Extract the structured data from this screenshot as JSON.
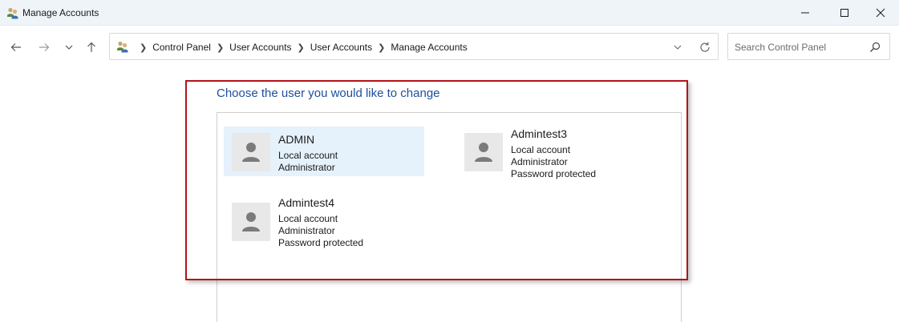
{
  "window": {
    "title": "Manage Accounts"
  },
  "nav": {
    "breadcrumbs": [
      "Control Panel",
      "User Accounts",
      "User Accounts",
      "Manage Accounts"
    ],
    "search_placeholder": "Search Control Panel"
  },
  "content": {
    "heading": "Choose the user you would like to change",
    "users": [
      {
        "name": "ADMIN",
        "lines": [
          "Local account",
          "Administrator"
        ],
        "selected": true
      },
      {
        "name": "Admintest3",
        "lines": [
          "Local account",
          "Administrator",
          "Password protected"
        ],
        "selected": false
      },
      {
        "name": "Admintest4",
        "lines": [
          "Local account",
          "Administrator",
          "Password protected"
        ],
        "selected": false
      }
    ]
  },
  "colors": {
    "heading": "#1e4e9c",
    "selected_tile": "#e5f1fb",
    "highlight_border": "#b3131a",
    "titlebar": "#eff4f9"
  },
  "icons": {
    "app": "users-group-icon",
    "user_avatar": "user-silhouette-icon"
  }
}
